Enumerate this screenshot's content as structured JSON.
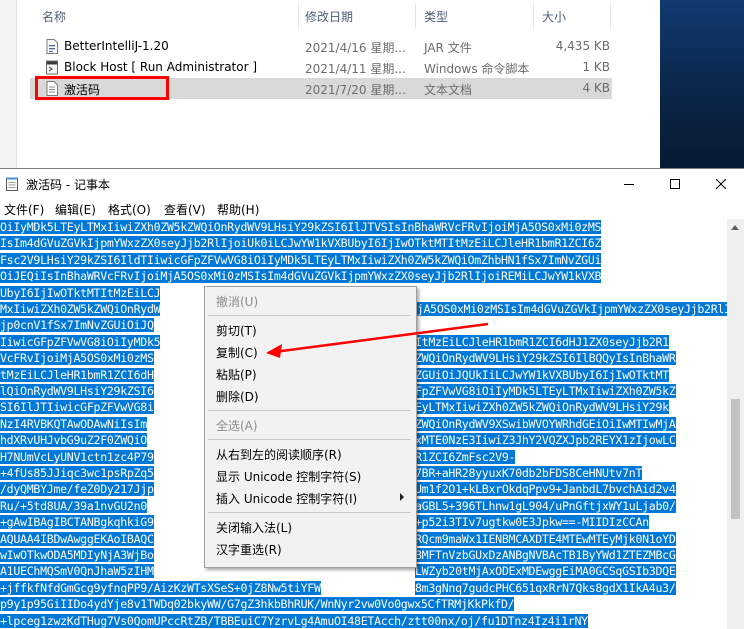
{
  "explorer": {
    "columns": {
      "name": "名称",
      "date": "修改日期",
      "type": "类型",
      "size": "大小"
    },
    "files": [
      {
        "name": "BetterIntelliJ-1.20",
        "date": "2021/4/16 星期...",
        "type": "JAR 文件",
        "size": "4,435 KB",
        "icon": "jar-file-icon"
      },
      {
        "name": "Block Host [ Run Administrator ]",
        "date": "2021/4/11 星期...",
        "type": "Windows 命令脚本",
        "size": "1 KB",
        "icon": "batch-script-icon"
      },
      {
        "name": "激活码",
        "date": "2021/7/20 星期...",
        "type": "文本文档",
        "size": "4 KB",
        "icon": "text-document-icon"
      }
    ]
  },
  "notepad": {
    "title": "激活码 - 记事本",
    "menu": [
      "文件(F)",
      "编辑(E)",
      "格式(O)",
      "查看(V)",
      "帮助(H)"
    ],
    "lines": [
      "OiIyMDk5LTEyLTMxIiwiZXh0ZW5kZWQiOnRydWV9LHsiY29kZSI6IlJTVSIsInBhaWRVcFRvIjoiMjA5OS0xMi0zMS",
      "IsIm4dGVuZGVkIjpmYWxzZX0seyJjb2RlIjoiUk0iLCJwYW1kVXBUbyI6IjIwOTktMTItMzEiLCJleHR1bmR1ZCI6Z",
      "Fsc2V9LHsiY29kZSI6IldTIiwicGFpZFVwVG8iOiIyMDk5LTEyLTMxIiwiZXh0ZW5kZWQiOmZhbHN1fSx7ImNvZGUi",
      "OiJEQiIsInBhaWRVcFRvIjoiMjA5OS0xMi0zMSIsIm4dGVuZGVkIjpmYWxzZX0seyJjb2RlIjoiREMiLCJwYW1kVXB",
      "UbyI6IjIwOTktMTItMzEiLCJ",
      "MxIiwiZXh0ZW5kZWQiOnRydW",
      "jp0cnV1fSx7ImNvZGUiOiJQ",
      "IiwicGFpZFVwVG8iOiIyMDk5",
      "VcFRvIjoiMjA5OS0xMi0zMS",
      "tMzEiLCJleHR1bmR1ZCI6dH",
      "lQiOnRydWV9LHsiY29kZSI6",
      "SI6IlJTIiwicGFpZFVwVG8i",
      "NzI4RVBKQTAwODAwNiIsIm",
      "hdXRvUHJvbG9uZ2F0ZWQiO",
      "H7NUmVcLyUNV1ctn1zc4P79",
      "+4fUs85JJiqc3wc1psRpZq5",
      "/dyQMBYJme/feZ0Dy217Jjp",
      "Ru/+5td8UA/39a1nvGU2n0",
      "+gAwIBAgIBCTANBgkqhkiG9",
      "AQUAA4IBDwAwggEKAoIBAQC",
      "wIwOTkwODA5MDIyNjA3WjBo",
      "A1UEChMQSmV0QnJhaW5zIHM",
      "+jffkfNfdGmGcg9yfnqPP9/AizKzWTsXSeS+0jZ8Nw5tiYFW",
      "p9y1p95GiIIDo4ydYje8v1TWDq02bkyWW/G7gZ3hkbBhRUK/WnNyr2vw0Vo0gwx5CfTRMjKkPkfD/",
      "+lpceg1zwzKdTHug7Vs0QomUPccRtZB/TBBEuiC7YzrvLg4AmuOI48ETAcch/ztt00nx/oj/fu1DTnz4Iz4i1rNY",
      "WtUDpP/RaeD60NmQ0kpt9t4pO"
    ],
    "tail_lines": [
      "VcFRvIjoiMjA5OS0xMi0zMSIsIm4dGVuZGVkIjpmYWxzZX0seyJjb2RlIjoiUERCIiwicGFpZFVwVG8iOiIyMDk5LTEyLT",
      "ItMzEiLCJleHR1bmR1ZCI6dHJ1ZX0seyJjb2R1",
      "ZWQiOnRydWV9LHsiY29kZSI6IlBQQyIsInBhaWR",
      "ZGUiOiJQUkIiLCJwYW1kVXBUbyI6IjIwOTktMT",
      "FpZFVwVG8iOiIyMDk5LTEyLTMxIiwiZXh0ZW5kZ",
      "EyLTMxIiwiZXh0ZW5kZWQiOnRydWV9LHsiY29k",
      "ZWQiOnRydWV9XSwibWVOYWRhdGEiOiIwMTIwMjA",
      "xMTE0NzE3IiwiZ3JhY2VQZXJpb2REYX1zIjowLC",
      "R1ZCI6ZmFsc2V9-",
      "7BR+aHR28yyuxK70db2bFDS8CeHNUtv7nT",
      "Um1f2O1+kLBxrOkdqPpv9+JanbdL7bvchAid2v4",
      "aGBL5+396TLhnw1gL904/uPnGftjxWY1uLjab0/",
      "+p52i3TIv7ugtkw0E3Jpkw==-MIIDIzCCAn",
      "RQcm9maWx1IENBMCAXDTE4MTEwMTEyMjk0N1oYD",
      "BMFTnVzbGUxDzANBgNVBAcTB1ByYWd1ZTEZMBcG",
      "LWZyb20tMjAxODExMDEwggEiMA0GCSqGSIb3DQE",
      "8m3gNnq7gudcPHC651qxRrN7Qks8gdX1IkA4u3/"
    ]
  },
  "context_menu": {
    "items": [
      {
        "label": "撤消(U)",
        "disabled": true
      },
      {
        "sep": true
      },
      {
        "label": "剪切(T)",
        "disabled": false
      },
      {
        "label": "复制(C)",
        "disabled": false
      },
      {
        "label": "粘贴(P)",
        "disabled": false
      },
      {
        "label": "删除(D)",
        "disabled": false
      },
      {
        "sep": true
      },
      {
        "label": "全选(A)",
        "disabled": true
      },
      {
        "sep": true
      },
      {
        "label": "从右到左的阅读顺序(R)",
        "disabled": false
      },
      {
        "label": "显示 Unicode 控制字符(S)",
        "disabled": false
      },
      {
        "label": "插入 Unicode 控制字符(I)",
        "disabled": false,
        "submenu": true
      },
      {
        "sep": true
      },
      {
        "label": "关闭输入法(L)",
        "disabled": false
      },
      {
        "label": "汉字重选(R)",
        "disabled": false
      }
    ]
  },
  "colors": {
    "selection": "#0078d7",
    "annotation": "#ff0000",
    "menu_bg": "#f2f2f2"
  }
}
